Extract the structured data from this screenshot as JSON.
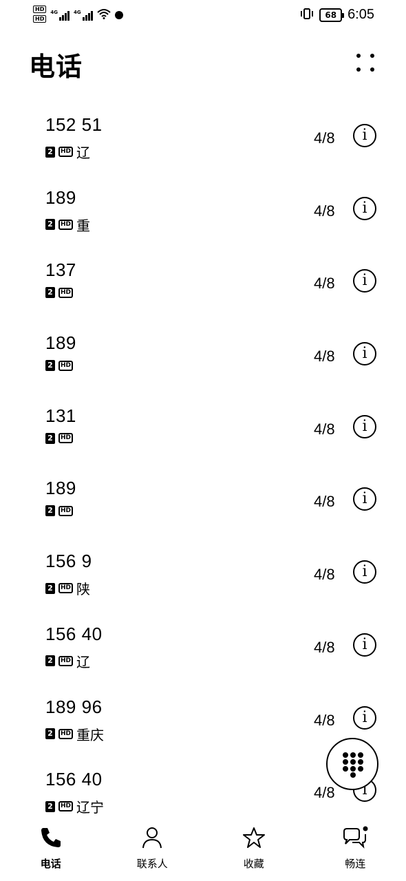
{
  "status_bar": {
    "hd_top": "HD",
    "hd_bottom": "HD",
    "sim1_network": "4G",
    "sim2_network": "4G",
    "battery": "68",
    "time": "6:05"
  },
  "header": {
    "title": "电话"
  },
  "calls": [
    {
      "number": "152 51",
      "location": "辽",
      "date": "4/8"
    },
    {
      "number": "189",
      "location": "重",
      "date": "4/8"
    },
    {
      "number": "137",
      "location": "",
      "date": "4/8"
    },
    {
      "number": "189",
      "location": "",
      "date": "4/8"
    },
    {
      "number": "131",
      "location": "",
      "date": "4/8"
    },
    {
      "number": "189",
      "location": "",
      "date": "4/8"
    },
    {
      "number": "156 9",
      "location": "陕",
      "date": "4/8"
    },
    {
      "number": "156 40",
      "location": "辽",
      "date": "4/8"
    },
    {
      "number": "189 96",
      "location": "重庆",
      "date": "4/8"
    },
    {
      "number": "156 40",
      "location": "辽宁",
      "date": "4/8"
    }
  ],
  "row_labels": {
    "sim_slot": "2",
    "hd": "HD"
  },
  "nav": {
    "items": [
      {
        "label": "电话",
        "icon": "phone-icon"
      },
      {
        "label": "联系人",
        "icon": "contact-icon"
      },
      {
        "label": "收藏",
        "icon": "star-icon"
      },
      {
        "label": "畅连",
        "icon": "meetime-icon"
      }
    ]
  }
}
